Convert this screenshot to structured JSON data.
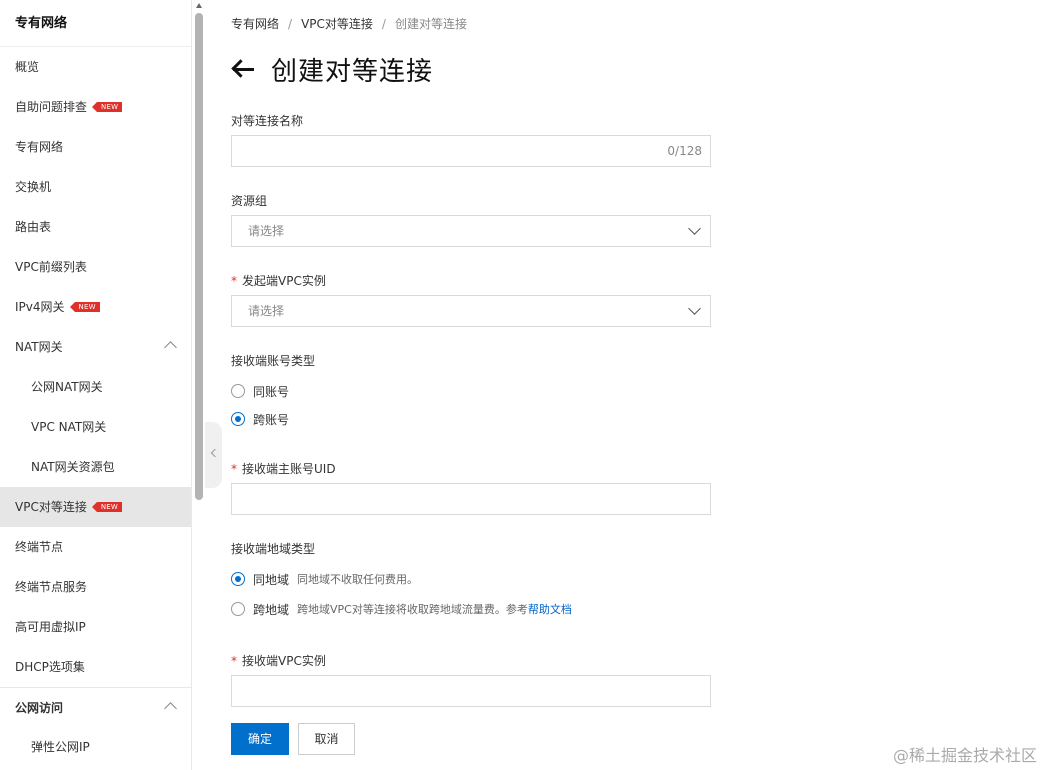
{
  "sidebar": {
    "header": "专有网络",
    "items": [
      {
        "label": "概览"
      },
      {
        "label": "自助问题排查",
        "badge": "NEW"
      },
      {
        "label": "专有网络"
      },
      {
        "label": "交换机"
      },
      {
        "label": "路由表"
      },
      {
        "label": "VPC前缀列表"
      },
      {
        "label": "IPv4网关",
        "badge": "NEW"
      },
      {
        "label": "NAT网关"
      },
      {
        "label": "公网NAT网关"
      },
      {
        "label": "VPC NAT网关"
      },
      {
        "label": "NAT网关资源包"
      },
      {
        "label": "VPC对等连接",
        "badge": "NEW"
      },
      {
        "label": "终端节点"
      },
      {
        "label": "终端节点服务"
      },
      {
        "label": "高可用虚拟IP"
      },
      {
        "label": "DHCP选项集"
      },
      {
        "label": "公网访问"
      },
      {
        "label": "弹性公网IP"
      }
    ]
  },
  "breadcrumb": [
    "专有网络",
    "VPC对等连接",
    "创建对等连接"
  ],
  "breadcrumb_sep": "/",
  "page_title": "创建对等连接",
  "form": {
    "name": {
      "label": "对等连接名称",
      "counter": "0/128",
      "value": ""
    },
    "resource_group": {
      "label": "资源组",
      "placeholder": "请选择"
    },
    "source_vpc": {
      "required": "*",
      "label": "发起端VPC实例",
      "placeholder": "请选择"
    },
    "account_type": {
      "label": "接收端账号类型",
      "options": [
        {
          "label": "同账号",
          "checked": false
        },
        {
          "label": "跨账号",
          "checked": true
        }
      ]
    },
    "uid": {
      "required": "*",
      "label": "接收端主账号UID",
      "value": ""
    },
    "region_type": {
      "label": "接收端地域类型",
      "options": [
        {
          "label": "同地域",
          "desc": "同地域不收取任何费用。",
          "checked": true
        },
        {
          "label": "跨地域",
          "desc": "跨地域VPC对等连接将收取跨地域流量费。参考",
          "link": "帮助文档",
          "checked": false
        }
      ]
    },
    "dest_vpc": {
      "required": "*",
      "label": "接收端VPC实例",
      "value": ""
    },
    "confirm_label": "确定",
    "cancel_label": "取消"
  },
  "watermark": "@稀土掘金技术社区",
  "colors": {
    "primary": "#0070cc",
    "badge": "#e0302a",
    "link": "#0064c8",
    "active_bg": "#e6e6e6"
  }
}
